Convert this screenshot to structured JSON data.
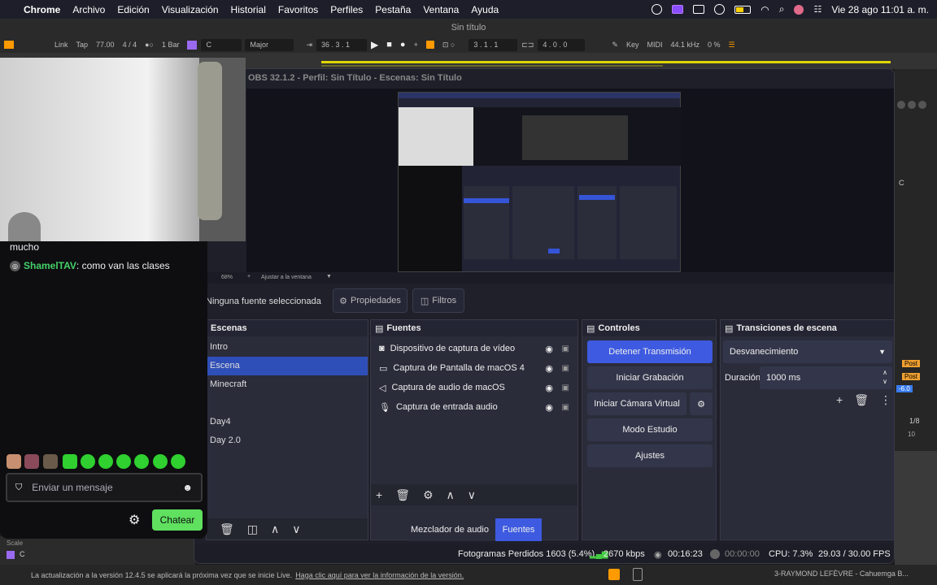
{
  "menubar": {
    "apple": "",
    "items": [
      "Chrome",
      "Archivo",
      "Edición",
      "Visualización",
      "Historial",
      "Favoritos",
      "Perfiles",
      "Pestaña",
      "Ventana",
      "Ayuda"
    ],
    "clock": "Vie 28 ago  11:01 a. m."
  },
  "ableton": {
    "title": "Sin título",
    "link": "Link",
    "tap": "Tap",
    "bpm": "77.00",
    "meter": "4 / 4",
    "quant": "1 Bar",
    "key": "C",
    "scale": "Major",
    "position": "36 .  3 .  1",
    "loop_start": "3 .  1 .  1",
    "loop_len": "4 .  0 .  0",
    "key_label": "Key",
    "midi_label": "MIDI",
    "sample_rate": "44.1 kHz",
    "cpu": "0 %",
    "post": "Post",
    "vol": "-6.0",
    "grid": "1/8",
    "ruler_mark": "10",
    "channel": "C",
    "scale_label": "Scale",
    "status": "La actualización a la versión 12.4.5 se aplicará la próxima vez que se inicie Live.",
    "status_link": "Haga clic aquí para ver la información de la versión.",
    "track_name": "3-RAYMOND LEFÈVRE - Cahuemga B..."
  },
  "obs": {
    "title": "OBS 32.1.2 - Perfil: Sin Título - Escenas: Sin Título",
    "zoom": "68%",
    "fit": "Ajustar a la ventana",
    "no_source": "Ninguna fuente seleccionada",
    "properties": "Propiedades",
    "filters": "Filtros",
    "scenes": {
      "title": "Escenas",
      "items": [
        "Intro",
        "Escena",
        "Minecraft",
        "",
        "Day4",
        "Day 2.0"
      ]
    },
    "sources": {
      "title": "Fuentes",
      "items": [
        "Dispositivo de captura de vídeo",
        "Captura de Pantalla de macOS 4",
        "Captura de audio de macOS",
        "Captura de entrada audio"
      ]
    },
    "controls": {
      "title": "Controles",
      "stop_stream": "Detener Transmisión",
      "start_record": "Iniciar Grabación",
      "virtual_cam": "Iniciar Cámara Virtual",
      "studio": "Modo Estudio",
      "settings": "Ajustes"
    },
    "transitions": {
      "title": "Transiciones de escena",
      "selected": "Desvanecimiento",
      "duration_label": "Duración",
      "duration_value": "1000 ms"
    },
    "tabs": {
      "mixer": "Mezclador de audio",
      "sources": "Fuentes"
    },
    "status": {
      "dropped": "Fotogramas Perdidos 1603 (5.4%)",
      "bitrate": "2670 kbps",
      "stream_time": "00:16:23",
      "rec_time": "00:00:00",
      "cpu": "CPU: 7.3%",
      "fps": "29.03 / 30.00 FPS"
    }
  },
  "chat": {
    "partial_message": "mucho",
    "user": "ShamelTAV",
    "message": ": como van las clases",
    "placeholder": "Enviar un mensaje",
    "send": "Chatear"
  },
  "colors": {
    "accent_blue": "#3d5ae0",
    "chat_green": "#5fe05f",
    "username_green": "#45d06a",
    "ableton_yellow": "#e0d600"
  }
}
